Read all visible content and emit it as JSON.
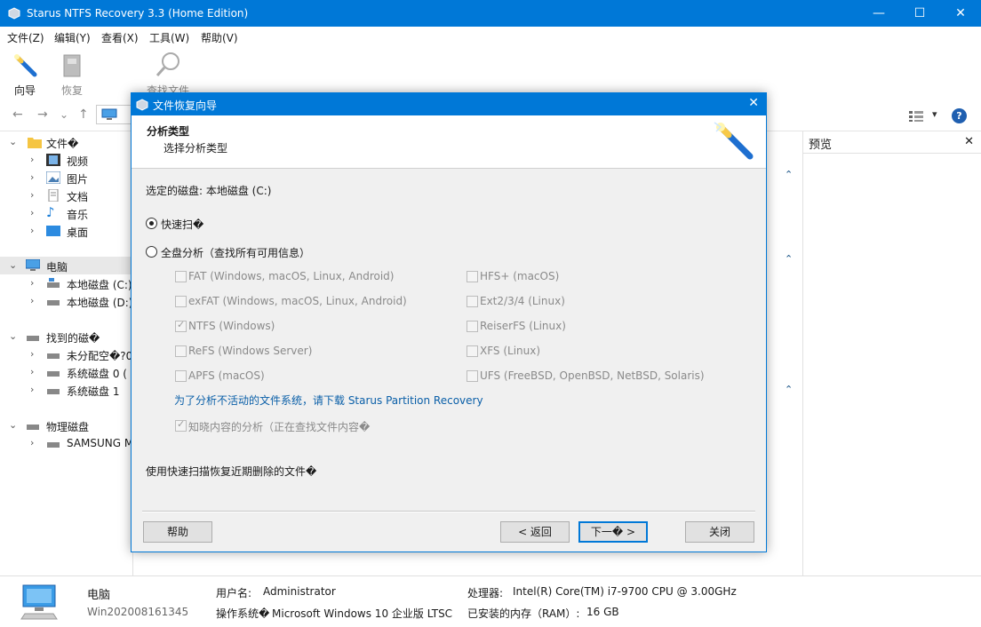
{
  "window": {
    "title": "Starus NTFS Recovery 3.3 (Home Edition)",
    "minimize": "—",
    "maximize": "☐",
    "close": "✕"
  },
  "menu": [
    "文件(Z)",
    "编辑(Y)",
    "查看(X)",
    "工具(W)",
    "帮助(V)"
  ],
  "toolbar": {
    "wizard_label": "向导",
    "recover_label": "恢复",
    "find_label": "查找文件"
  },
  "addrbar": {
    "back": "←",
    "forward": "→",
    "dropdown": "⌄",
    "up": "↑",
    "help": "?",
    "view_dropdown": "▾"
  },
  "tree": {
    "files": {
      "label": "文件�",
      "items": [
        "视频",
        "图片",
        "文档",
        "音乐",
        "桌面"
      ]
    },
    "computer": {
      "label": "电脑",
      "items": [
        "本地磁盘 (C:)",
        "本地磁盘 (D:)"
      ]
    },
    "found": {
      "label": "找到的磁�",
      "items": [
        "未分配空�?0",
        "系统磁盘 0 (",
        "系统磁盘 1"
      ]
    },
    "physical": {
      "label": "物理磁盘",
      "items": [
        "SAMSUNG MZ"
      ]
    }
  },
  "preview": {
    "title": "预览",
    "close": "✕"
  },
  "status": {
    "computer_label": "电脑",
    "computer_name": "Win202008161345",
    "user_label": "用户名:",
    "user_value": "Administrator",
    "os_label": "操作系统�",
    "os_value": "Microsoft Windows 10 企业版 LTSC",
    "cpu_label": "处理器:",
    "cpu_value": "Intel(R) Core(TM) i7-9700 CPU @ 3.00GHz",
    "ram_label": "已安装的内存（RAM）:",
    "ram_value": "16 GB"
  },
  "dialog": {
    "title": "文件恢复向导",
    "close": "✕",
    "header_title": "分析类型",
    "header_subtitle": "选择分析类型",
    "selected_disk": "选定的磁盘: 本地磁盘 (C:)",
    "quick_scan": "快速扫�",
    "full_analysis": "全盘分析（查找所有可用信息）",
    "fs_left": [
      {
        "label": "FAT (Windows, macOS, Linux, Android)",
        "checked": false
      },
      {
        "label": "exFAT (Windows, macOS, Linux, Android)",
        "checked": false
      },
      {
        "label": "NTFS (Windows)",
        "checked": true
      },
      {
        "label": "ReFS (Windows Server)",
        "checked": false
      },
      {
        "label": "APFS (macOS)",
        "checked": false
      }
    ],
    "fs_right": [
      {
        "label": "HFS+ (macOS)",
        "checked": false
      },
      {
        "label": "Ext2/3/4 (Linux)",
        "checked": false
      },
      {
        "label": "ReiserFS (Linux)",
        "checked": false
      },
      {
        "label": "XFS (Linux)",
        "checked": false
      },
      {
        "label": "UFS (FreeBSD, OpenBSD, NetBSD, Solaris)",
        "checked": false
      }
    ],
    "download_link": "为了分析不活动的文件系统，请下载 Starus Partition Recovery",
    "content_analysis": "知晓内容的分析（正在查找文件内容�",
    "hint": "使用快速扫描恢复近期删除的文件�",
    "btn_help": "帮助",
    "btn_back": "< 返回",
    "btn_next": "下一� >",
    "btn_close": "关闭"
  }
}
